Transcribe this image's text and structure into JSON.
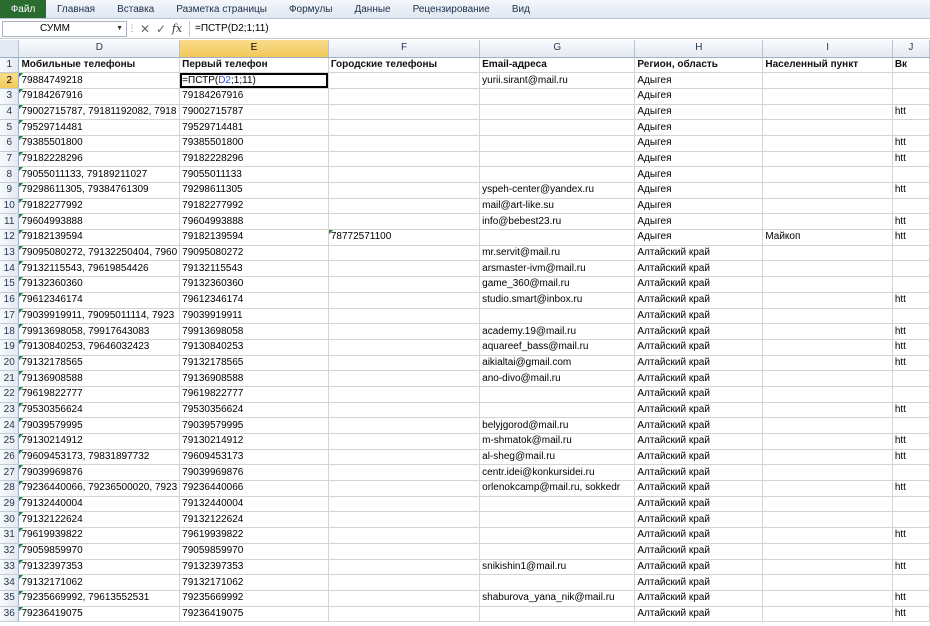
{
  "ribbon": {
    "tabs": [
      "Файл",
      "Главная",
      "Вставка",
      "Разметка страницы",
      "Формулы",
      "Данные",
      "Рецензирование",
      "Вид"
    ]
  },
  "formula_bar": {
    "name_box": "СУММ",
    "formula": "=ПСТР(D2;1;11)",
    "cancel_icon": "✕",
    "enter_icon": "✓",
    "fx_label": "fx"
  },
  "columns": [
    "D",
    "E",
    "F",
    "G",
    "H",
    "I",
    "J"
  ],
  "selected_column": "E",
  "selected_row": "2",
  "active_cell": {
    "formula_prefix": "=ПСТР(",
    "formula_ref": "D2",
    "formula_suffix": ";1;11)"
  },
  "header_row": {
    "row": "1",
    "cells": [
      "Мобильные телефоны",
      "Первый телефон",
      "Городские телефоны",
      "Email-адреса",
      "Регион, область",
      "Населенный пункт",
      "Вк"
    ]
  },
  "rows": [
    {
      "row": "2",
      "cells": [
        "79884749218",
        "",
        "",
        "yurii.sirant@mail.ru",
        "Адыгея",
        "",
        ""
      ]
    },
    {
      "row": "3",
      "cells": [
        "79184267916",
        "79184267916",
        "",
        "",
        "Адыгея",
        "",
        ""
      ]
    },
    {
      "row": "4",
      "cells": [
        "79002715787, 79181192082, 7918",
        "79002715787",
        "",
        "",
        "Адыгея",
        "",
        "htt"
      ]
    },
    {
      "row": "5",
      "cells": [
        "79529714481",
        "79529714481",
        "",
        "",
        "Адыгея",
        "",
        ""
      ]
    },
    {
      "row": "6",
      "cells": [
        "79385501800",
        "79385501800",
        "",
        "",
        "Адыгея",
        "",
        "htt"
      ]
    },
    {
      "row": "7",
      "cells": [
        "79182228296",
        "79182228296",
        "",
        "",
        "Адыгея",
        "",
        "htt"
      ]
    },
    {
      "row": "8",
      "cells": [
        "79055011133, 79189211027",
        "79055011133",
        "",
        "",
        "Адыгея",
        "",
        ""
      ]
    },
    {
      "row": "9",
      "cells": [
        "79298611305, 79384761309",
        "79298611305",
        "",
        "yspeh-center@yandex.ru",
        "Адыгея",
        "",
        "htt"
      ]
    },
    {
      "row": "10",
      "cells": [
        "79182277992",
        "79182277992",
        "",
        "mail@art-like.su",
        "Адыгея",
        "",
        ""
      ]
    },
    {
      "row": "11",
      "cells": [
        "79604993888",
        "79604993888",
        "",
        "info@bebest23.ru",
        "Адыгея",
        "",
        "htt"
      ]
    },
    {
      "row": "12",
      "cells": [
        "79182139594",
        "79182139594",
        "78772571100",
        "",
        "Адыгея",
        "Майкоп",
        "htt"
      ]
    },
    {
      "row": "13",
      "cells": [
        "79095080272, 79132250404, 7960",
        "79095080272",
        "",
        "mr.servit@mail.ru",
        "Алтайский край",
        "",
        ""
      ]
    },
    {
      "row": "14",
      "cells": [
        "79132115543, 79619854426",
        "79132115543",
        "",
        "arsmaster-ivm@mail.ru",
        "Алтайский край",
        "",
        ""
      ]
    },
    {
      "row": "15",
      "cells": [
        "79132360360",
        "79132360360",
        "",
        "game_360@mail.ru",
        "Алтайский край",
        "",
        ""
      ]
    },
    {
      "row": "16",
      "cells": [
        "79612346174",
        "79612346174",
        "",
        "studio.smart@inbox.ru",
        "Алтайский край",
        "",
        "htt"
      ]
    },
    {
      "row": "17",
      "cells": [
        "79039919911, 79095011114, 7923",
        "79039919911",
        "",
        "",
        "Алтайский край",
        "",
        ""
      ]
    },
    {
      "row": "18",
      "cells": [
        "79913698058, 79917643083",
        "79913698058",
        "",
        "academy.19@mail.ru",
        "Алтайский край",
        "",
        "htt"
      ]
    },
    {
      "row": "19",
      "cells": [
        "79130840253, 79646032423",
        "79130840253",
        "",
        "aquareef_bass@mail.ru",
        "Алтайский край",
        "",
        "htt"
      ]
    },
    {
      "row": "20",
      "cells": [
        "79132178565",
        "79132178565",
        "",
        "aikialtai@gmail.com",
        "Алтайский край",
        "",
        "htt"
      ]
    },
    {
      "row": "21",
      "cells": [
        "79136908588",
        "79136908588",
        "",
        "ano-divo@mail.ru",
        "Алтайский край",
        "",
        ""
      ]
    },
    {
      "row": "22",
      "cells": [
        "79619822777",
        "79619822777",
        "",
        "",
        "Алтайский край",
        "",
        ""
      ]
    },
    {
      "row": "23",
      "cells": [
        "79530356624",
        "79530356624",
        "",
        "",
        "Алтайский край",
        "",
        "htt"
      ]
    },
    {
      "row": "24",
      "cells": [
        "79039579995",
        "79039579995",
        "",
        "belyjgorod@mail.ru",
        "Алтайский край",
        "",
        ""
      ]
    },
    {
      "row": "25",
      "cells": [
        "79130214912",
        "79130214912",
        "",
        "m-shmatok@mail.ru",
        "Алтайский край",
        "",
        "htt"
      ]
    },
    {
      "row": "26",
      "cells": [
        "79609453173, 79831897732",
        "79609453173",
        "",
        "al-sheg@mail.ru",
        "Алтайский край",
        "",
        "htt"
      ]
    },
    {
      "row": "27",
      "cells": [
        "79039969876",
        "79039969876",
        "",
        "centr.idei@konkursidei.ru",
        "Алтайский край",
        "",
        ""
      ]
    },
    {
      "row": "28",
      "cells": [
        "79236440066, 79236500020, 7923",
        "79236440066",
        "",
        "orlenokcamp@mail.ru, sokkedr",
        "Алтайский край",
        "",
        "htt"
      ]
    },
    {
      "row": "29",
      "cells": [
        "79132440004",
        "79132440004",
        "",
        "",
        "Алтайский край",
        "",
        ""
      ]
    },
    {
      "row": "30",
      "cells": [
        "79132122624",
        "79132122624",
        "",
        "",
        "Алтайский край",
        "",
        ""
      ]
    },
    {
      "row": "31",
      "cells": [
        "79619939822",
        "79619939822",
        "",
        "",
        "Алтайский край",
        "",
        "htt"
      ]
    },
    {
      "row": "32",
      "cells": [
        "79059859970",
        "79059859970",
        "",
        "",
        "Алтайский край",
        "",
        ""
      ]
    },
    {
      "row": "33",
      "cells": [
        "79132397353",
        "79132397353",
        "",
        "snikishin1@mail.ru",
        "Алтайский край",
        "",
        "htt"
      ]
    },
    {
      "row": "34",
      "cells": [
        "79132171062",
        "79132171062",
        "",
        "",
        "Алтайский край",
        "",
        ""
      ]
    },
    {
      "row": "35",
      "cells": [
        "79235669992, 79613552531",
        "79235669992",
        "",
        "shaburova_yana_nik@mail.ru",
        "Алтайский край",
        "",
        "htt"
      ]
    },
    {
      "row": "36",
      "cells": [
        "79236419075",
        "79236419075",
        "",
        "",
        "Алтайский край",
        "",
        "htt"
      ]
    }
  ]
}
